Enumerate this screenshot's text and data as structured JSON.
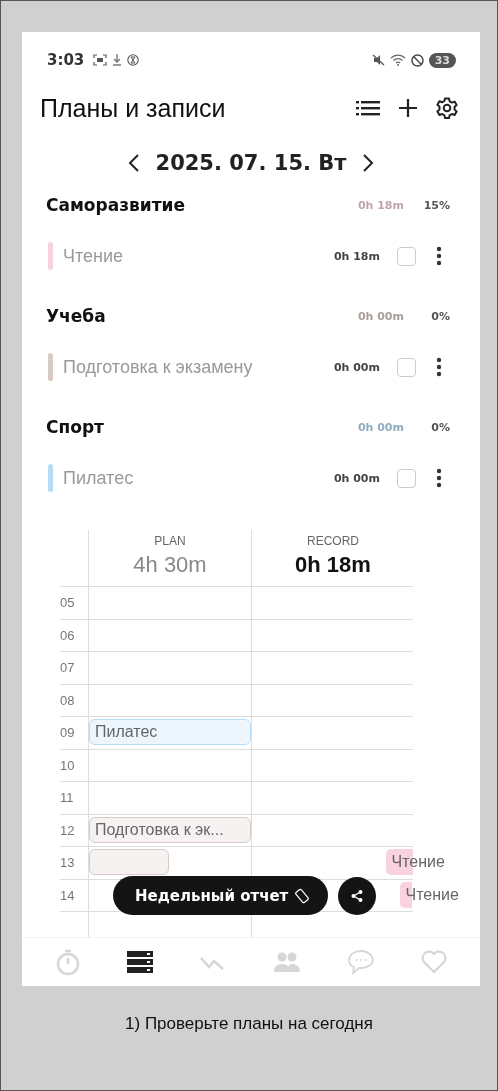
{
  "status_bar": {
    "time": "3:03",
    "battery": "33"
  },
  "header": {
    "title": "Планы и записи"
  },
  "date_nav": {
    "date": "2025. 07. 15. Вт"
  },
  "categories": [
    {
      "name": "Саморазвитие",
      "total": "0h 18m",
      "percent": "15%",
      "color": "#f8d3dd",
      "tasks": [
        {
          "name": "Чтение",
          "time": "0h 18m",
          "checked": false
        }
      ]
    },
    {
      "name": "Учеба",
      "total": "0h 00m",
      "percent": "0%",
      "color": "#d8cbc6",
      "tasks": [
        {
          "name": "Подготовка к экзамену",
          "time": "0h 00m",
          "checked": false
        }
      ]
    },
    {
      "name": "Спорт",
      "total": "0h 00m",
      "percent": "0%",
      "color": "#b9dcf6",
      "tasks": [
        {
          "name": "Пилатес",
          "time": "0h 00m",
          "checked": false
        }
      ]
    }
  ],
  "timeline": {
    "plan_label": "PLAN",
    "plan_total": "4h 30m",
    "record_label": "RECORD",
    "record_total": "0h 18m",
    "hours": [
      {
        "label": "05"
      },
      {
        "label": "06"
      },
      {
        "label": "07"
      },
      {
        "label": "08"
      },
      {
        "label": "09",
        "plan": {
          "label": "Пилатес",
          "kind": "full",
          "color": "#b9dcf6"
        }
      },
      {
        "label": "10"
      },
      {
        "label": "11"
      },
      {
        "label": "12",
        "plan": {
          "label": "Подготовка к эк...",
          "kind": "full",
          "color": "#d8cbc6"
        }
      },
      {
        "label": "13",
        "plan": {
          "kind": "partial",
          "color": "#d8cbc6"
        },
        "record": {
          "label": "Чтение",
          "kind": "wide",
          "color": "#f8d3dd"
        }
      },
      {
        "label": "14",
        "record": {
          "label": "Чтение",
          "kind": "narrow",
          "color": "#f8d3dd"
        }
      }
    ]
  },
  "report_button": {
    "label": "Недельный отчет"
  },
  "bottom_nav": [
    {
      "kind": "timer",
      "selected": false
    },
    {
      "kind": "plans",
      "selected": true
    },
    {
      "kind": "stats",
      "selected": false
    },
    {
      "kind": "friends",
      "selected": false
    },
    {
      "kind": "chat",
      "selected": false
    },
    {
      "kind": "like",
      "selected": false
    }
  ],
  "caption": "1) Проверьте планы на сегодня"
}
